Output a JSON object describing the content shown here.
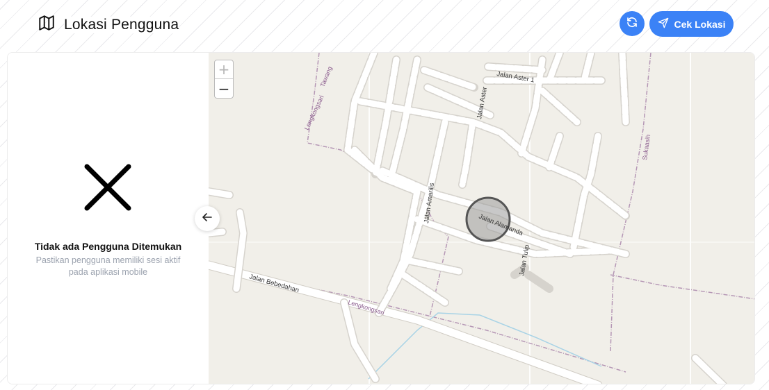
{
  "header": {
    "title": "Lokasi Pengguna",
    "title_icon": "map-icon",
    "refresh_icon": "refresh-icon",
    "cek_label": "Cek Lokasi",
    "cek_icon": "send-icon"
  },
  "empty_state": {
    "icon": "close-icon",
    "title": "Tidak ada Pengguna Ditemukan",
    "description": "Pastikan pengguna memiliki sesi aktif pada aplikasi mobile"
  },
  "map": {
    "zoom_in": "+",
    "zoom_out": "−",
    "streets": {
      "aster_1": "Jalan Aster 1",
      "aster": "Jalan Aster",
      "amarilis": "Jalan Amarilis",
      "alamanda": "Jalan Alamanda",
      "tulip": "Jalan Tulip",
      "bebedahan": "Jalan Bebedahan"
    },
    "areas": {
      "lengkongsari_top": "Lengkongsari",
      "tawang": "Tawang",
      "sukaasih": "Sukaasih",
      "lengkongsari_bottom": "Lengkongsari"
    }
  },
  "colors": {
    "accent": "#3b82f6",
    "map_bg": "#f1efe9",
    "road": "#ffffff",
    "marker": "#9a9a9a"
  }
}
